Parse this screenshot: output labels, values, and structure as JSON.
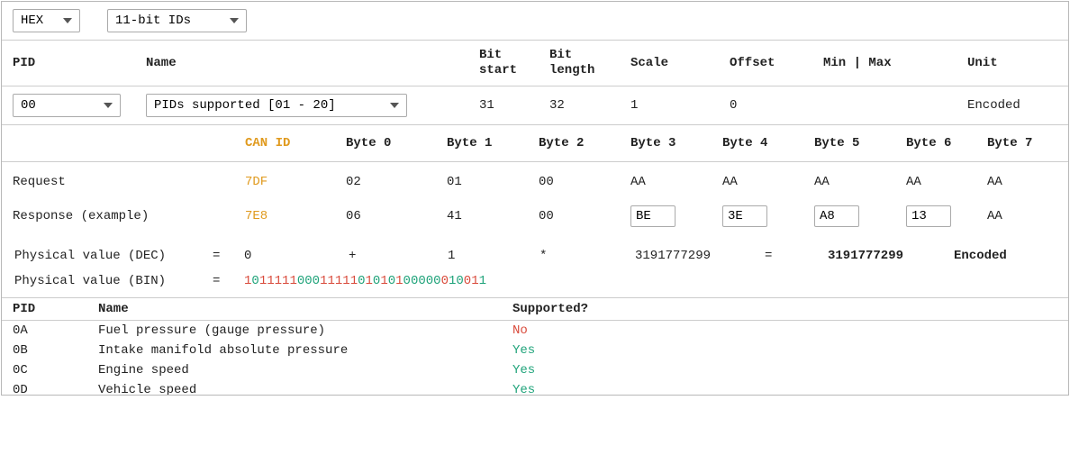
{
  "toolbar": {
    "format": "HEX",
    "id_mode": "11-bit IDs"
  },
  "headers": {
    "pid": "PID",
    "name": "Name",
    "bit_start": "Bit start",
    "bit_length": "Bit length",
    "scale": "Scale",
    "offset": "Offset",
    "minmax": "Min | Max",
    "unit": "Unit"
  },
  "selection": {
    "pid": "00",
    "name": "PIDs supported [01 - 20]",
    "bit_start": "31",
    "bit_length": "32",
    "scale": "1",
    "offset": "0",
    "minmax": "",
    "unit": "Encoded"
  },
  "byte_headers": {
    "can_id": "CAN ID",
    "b0": "Byte 0",
    "b1": "Byte 1",
    "b2": "Byte 2",
    "b3": "Byte 3",
    "b4": "Byte 4",
    "b5": "Byte 5",
    "b6": "Byte 6",
    "b7": "Byte 7"
  },
  "request": {
    "label": "Request",
    "can_id": "7DF",
    "b0": "02",
    "b1": "01",
    "b2": "00",
    "b3": "AA",
    "b4": "AA",
    "b5": "AA",
    "b6": "AA",
    "b7": "AA"
  },
  "response": {
    "label": "Response (example)",
    "can_id": "7E8",
    "b0": "06",
    "b1": "41",
    "b2": "00",
    "b3": "BE",
    "b4": "3E",
    "b5": "A8",
    "b6": "13",
    "b7": "AA"
  },
  "phys_dec": {
    "label": "Physical value (DEC)",
    "eq": "=",
    "offset": "0",
    "plus": "+",
    "scale": "1",
    "star": "*",
    "raw": "3191777299",
    "eq2": "=",
    "result": "3191777299",
    "unit": "Encoded"
  },
  "phys_bin": {
    "label": "Physical value (BIN)",
    "eq": "=",
    "bits": "10111110001111101010100000010011",
    "pattern": "rgrrrrrgggrrrrrgrgrgrgggggrggrr"
  },
  "supported": {
    "headers": {
      "pid": "PID",
      "name": "Name",
      "supported": "Supported?"
    },
    "rows": [
      {
        "pid": "0A",
        "name": "Fuel pressure (gauge pressure)",
        "supported": "No",
        "cls": "no"
      },
      {
        "pid": "0B",
        "name": "Intake manifold absolute pressure",
        "supported": "Yes",
        "cls": "yes"
      },
      {
        "pid": "0C",
        "name": "Engine speed",
        "supported": "Yes",
        "cls": "yes"
      },
      {
        "pid": "0D",
        "name": "Vehicle speed",
        "supported": "Yes",
        "cls": "yes"
      }
    ]
  }
}
